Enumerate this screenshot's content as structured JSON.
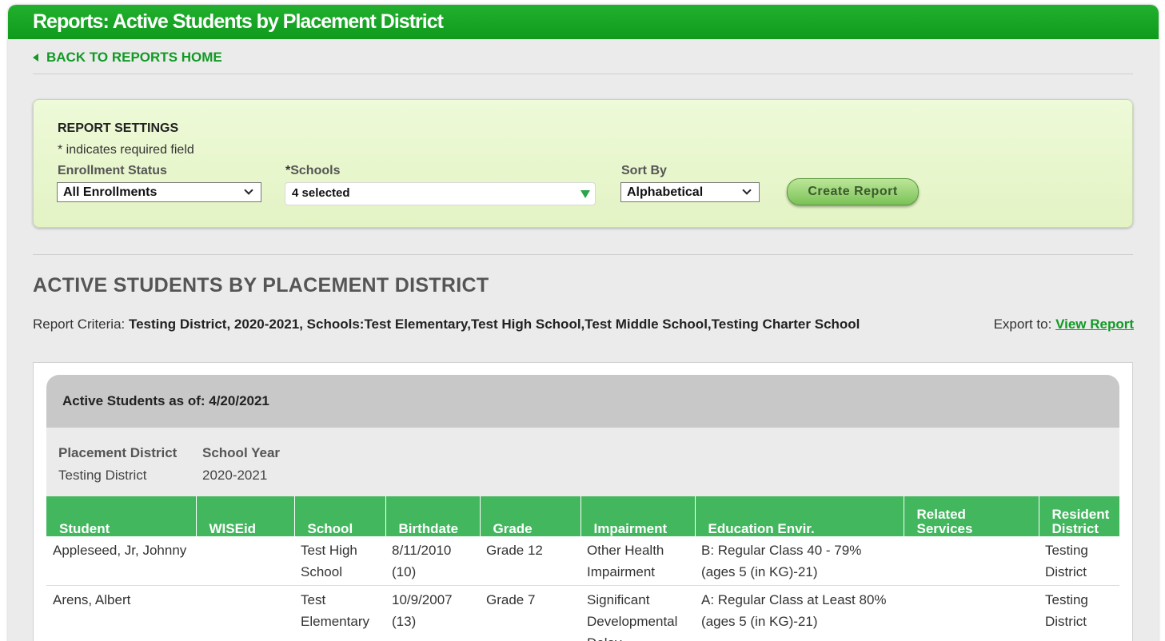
{
  "header": {
    "title": "Reports: Active Students by Placement District"
  },
  "nav": {
    "back_label": "BACK TO REPORTS HOME"
  },
  "settings": {
    "title": "REPORT SETTINGS",
    "required_note": "* indicates required field",
    "enrollment": {
      "label": "Enrollment Status",
      "value": "All Enrollments"
    },
    "schools": {
      "required_mark": "*",
      "label": "Schools",
      "value": "4 selected"
    },
    "sort": {
      "label": "Sort By",
      "value": "Alphabetical"
    },
    "create_button": "Create Report"
  },
  "report": {
    "title": "ACTIVE STUDENTS BY PLACEMENT DISTRICT",
    "criteria_label": "Report Criteria: ",
    "criteria_value": "Testing District, 2020-2021, Schools:Test Elementary,Test High School,Test Middle School,Testing Charter School",
    "export_label": "Export to: ",
    "export_link": "View Report",
    "as_of": "Active Students as of: 4/20/2021",
    "meta": {
      "placement_label": "Placement District",
      "placement_value": "Testing District",
      "year_label": "School Year",
      "year_value": "2020-2021"
    },
    "columns": [
      "Student",
      "WISEid",
      "School",
      "Birthdate",
      "Grade",
      "Impairment",
      "Education Envir.",
      "Related Services",
      "Resident District"
    ],
    "rows": [
      {
        "student": "Appleseed, Jr, Johnny",
        "wiseid": "",
        "school": "Test High School",
        "birthdate": "8/11/2010 (10)",
        "grade": "Grade 12",
        "impairment": "Other Health Impairment",
        "edenv": "B: Regular Class 40 - 79% (ages 5 (in KG)-21)",
        "related": "",
        "resident": "Testing District"
      },
      {
        "student": "Arens, Albert",
        "wiseid": "",
        "school": "Test Elementary",
        "birthdate": "10/9/2007 (13)",
        "grade": "Grade 7",
        "impairment": "Significant Developmental Delay",
        "edenv": "A: Regular Class at Least 80% (ages 5 (in KG)-21)",
        "related": "",
        "resident": "Testing District"
      }
    ]
  }
}
